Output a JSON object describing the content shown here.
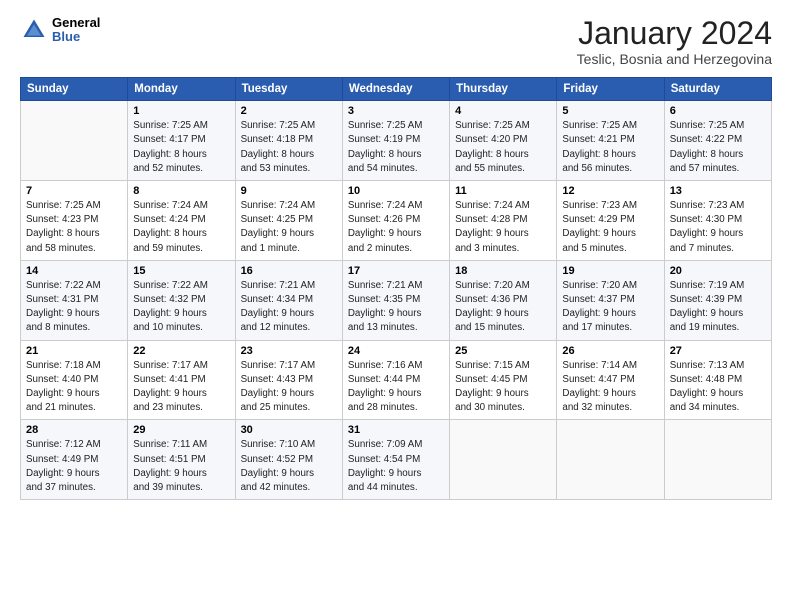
{
  "header": {
    "logo_general": "General",
    "logo_blue": "Blue",
    "month_year": "January 2024",
    "location": "Teslic, Bosnia and Herzegovina"
  },
  "days_of_week": [
    "Sunday",
    "Monday",
    "Tuesday",
    "Wednesday",
    "Thursday",
    "Friday",
    "Saturday"
  ],
  "weeks": [
    [
      {
        "num": "",
        "info": ""
      },
      {
        "num": "1",
        "info": "Sunrise: 7:25 AM\nSunset: 4:17 PM\nDaylight: 8 hours\nand 52 minutes."
      },
      {
        "num": "2",
        "info": "Sunrise: 7:25 AM\nSunset: 4:18 PM\nDaylight: 8 hours\nand 53 minutes."
      },
      {
        "num": "3",
        "info": "Sunrise: 7:25 AM\nSunset: 4:19 PM\nDaylight: 8 hours\nand 54 minutes."
      },
      {
        "num": "4",
        "info": "Sunrise: 7:25 AM\nSunset: 4:20 PM\nDaylight: 8 hours\nand 55 minutes."
      },
      {
        "num": "5",
        "info": "Sunrise: 7:25 AM\nSunset: 4:21 PM\nDaylight: 8 hours\nand 56 minutes."
      },
      {
        "num": "6",
        "info": "Sunrise: 7:25 AM\nSunset: 4:22 PM\nDaylight: 8 hours\nand 57 minutes."
      }
    ],
    [
      {
        "num": "7",
        "info": "Sunrise: 7:25 AM\nSunset: 4:23 PM\nDaylight: 8 hours\nand 58 minutes."
      },
      {
        "num": "8",
        "info": "Sunrise: 7:24 AM\nSunset: 4:24 PM\nDaylight: 8 hours\nand 59 minutes."
      },
      {
        "num": "9",
        "info": "Sunrise: 7:24 AM\nSunset: 4:25 PM\nDaylight: 9 hours\nand 1 minute."
      },
      {
        "num": "10",
        "info": "Sunrise: 7:24 AM\nSunset: 4:26 PM\nDaylight: 9 hours\nand 2 minutes."
      },
      {
        "num": "11",
        "info": "Sunrise: 7:24 AM\nSunset: 4:28 PM\nDaylight: 9 hours\nand 3 minutes."
      },
      {
        "num": "12",
        "info": "Sunrise: 7:23 AM\nSunset: 4:29 PM\nDaylight: 9 hours\nand 5 minutes."
      },
      {
        "num": "13",
        "info": "Sunrise: 7:23 AM\nSunset: 4:30 PM\nDaylight: 9 hours\nand 7 minutes."
      }
    ],
    [
      {
        "num": "14",
        "info": "Sunrise: 7:22 AM\nSunset: 4:31 PM\nDaylight: 9 hours\nand 8 minutes."
      },
      {
        "num": "15",
        "info": "Sunrise: 7:22 AM\nSunset: 4:32 PM\nDaylight: 9 hours\nand 10 minutes."
      },
      {
        "num": "16",
        "info": "Sunrise: 7:21 AM\nSunset: 4:34 PM\nDaylight: 9 hours\nand 12 minutes."
      },
      {
        "num": "17",
        "info": "Sunrise: 7:21 AM\nSunset: 4:35 PM\nDaylight: 9 hours\nand 13 minutes."
      },
      {
        "num": "18",
        "info": "Sunrise: 7:20 AM\nSunset: 4:36 PM\nDaylight: 9 hours\nand 15 minutes."
      },
      {
        "num": "19",
        "info": "Sunrise: 7:20 AM\nSunset: 4:37 PM\nDaylight: 9 hours\nand 17 minutes."
      },
      {
        "num": "20",
        "info": "Sunrise: 7:19 AM\nSunset: 4:39 PM\nDaylight: 9 hours\nand 19 minutes."
      }
    ],
    [
      {
        "num": "21",
        "info": "Sunrise: 7:18 AM\nSunset: 4:40 PM\nDaylight: 9 hours\nand 21 minutes."
      },
      {
        "num": "22",
        "info": "Sunrise: 7:17 AM\nSunset: 4:41 PM\nDaylight: 9 hours\nand 23 minutes."
      },
      {
        "num": "23",
        "info": "Sunrise: 7:17 AM\nSunset: 4:43 PM\nDaylight: 9 hours\nand 25 minutes."
      },
      {
        "num": "24",
        "info": "Sunrise: 7:16 AM\nSunset: 4:44 PM\nDaylight: 9 hours\nand 28 minutes."
      },
      {
        "num": "25",
        "info": "Sunrise: 7:15 AM\nSunset: 4:45 PM\nDaylight: 9 hours\nand 30 minutes."
      },
      {
        "num": "26",
        "info": "Sunrise: 7:14 AM\nSunset: 4:47 PM\nDaylight: 9 hours\nand 32 minutes."
      },
      {
        "num": "27",
        "info": "Sunrise: 7:13 AM\nSunset: 4:48 PM\nDaylight: 9 hours\nand 34 minutes."
      }
    ],
    [
      {
        "num": "28",
        "info": "Sunrise: 7:12 AM\nSunset: 4:49 PM\nDaylight: 9 hours\nand 37 minutes."
      },
      {
        "num": "29",
        "info": "Sunrise: 7:11 AM\nSunset: 4:51 PM\nDaylight: 9 hours\nand 39 minutes."
      },
      {
        "num": "30",
        "info": "Sunrise: 7:10 AM\nSunset: 4:52 PM\nDaylight: 9 hours\nand 42 minutes."
      },
      {
        "num": "31",
        "info": "Sunrise: 7:09 AM\nSunset: 4:54 PM\nDaylight: 9 hours\nand 44 minutes."
      },
      {
        "num": "",
        "info": ""
      },
      {
        "num": "",
        "info": ""
      },
      {
        "num": "",
        "info": ""
      }
    ]
  ]
}
